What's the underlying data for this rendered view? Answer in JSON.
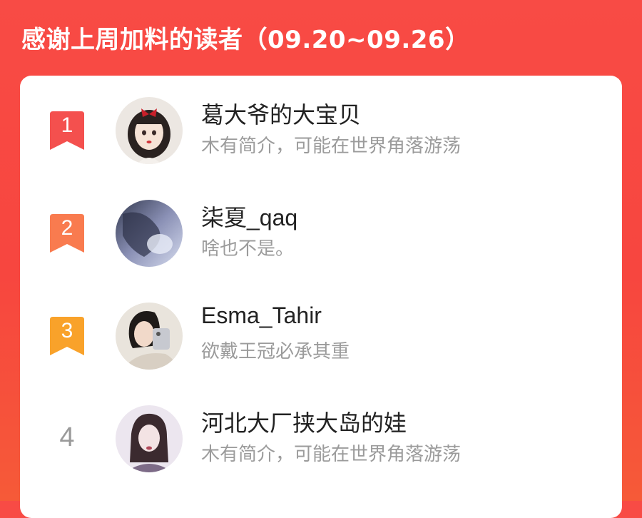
{
  "header": {
    "title": "感谢上周加料的读者（09.20~09.26）"
  },
  "colors": {
    "background": "#f84b45",
    "rank1": "#f4504e",
    "rank2": "#f97b4f",
    "rank3": "#f9a22a",
    "rank_plain": "#9a9a9a"
  },
  "readers": [
    {
      "rank": "1",
      "name": "葛大爷的大宝贝",
      "bio": "木有简介，可能在世界角落游荡",
      "avatar": "cartoon-girl-avatar"
    },
    {
      "rank": "2",
      "name": "柒夏_qaq",
      "bio": "啥也不是。",
      "avatar": "blue-photo-avatar"
    },
    {
      "rank": "3",
      "name": "Esma_Tahir",
      "bio": "欲戴王冠必承其重",
      "avatar": "selfie-avatar"
    },
    {
      "rank": "4",
      "name": "河北大厂挟大岛的娃",
      "bio": "木有简介，可能在世界角落游荡",
      "avatar": "portrait-avatar"
    }
  ]
}
